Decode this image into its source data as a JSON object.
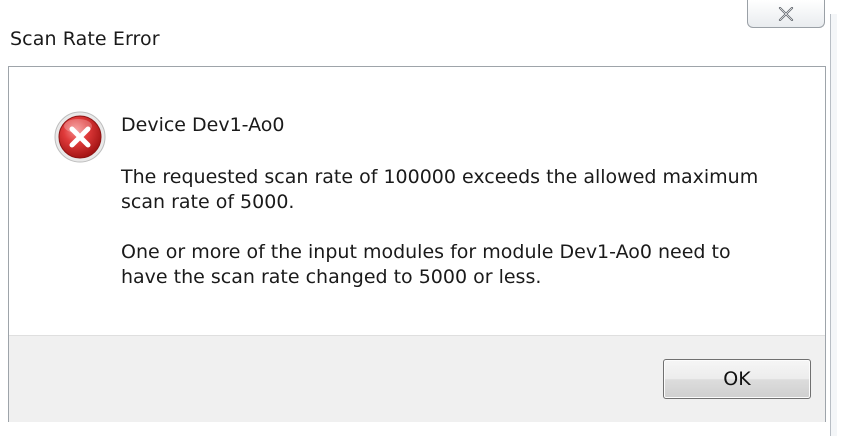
{
  "dialog": {
    "title": "Scan Rate Error",
    "icon": "error-icon",
    "heading": "Device Dev1-Ao0",
    "message_1": "The requested scan rate of 100000 exceeds the allowed maximum scan rate of 5000.",
    "message_2": "One or more of the input modules for module Dev1-Ao0 need to have the scan rate changed to 5000 or less.",
    "ok_label": "OK",
    "close_icon": "close-icon"
  },
  "colors": {
    "error_red": "#d9262c",
    "footer_bg": "#f0f0f0"
  }
}
